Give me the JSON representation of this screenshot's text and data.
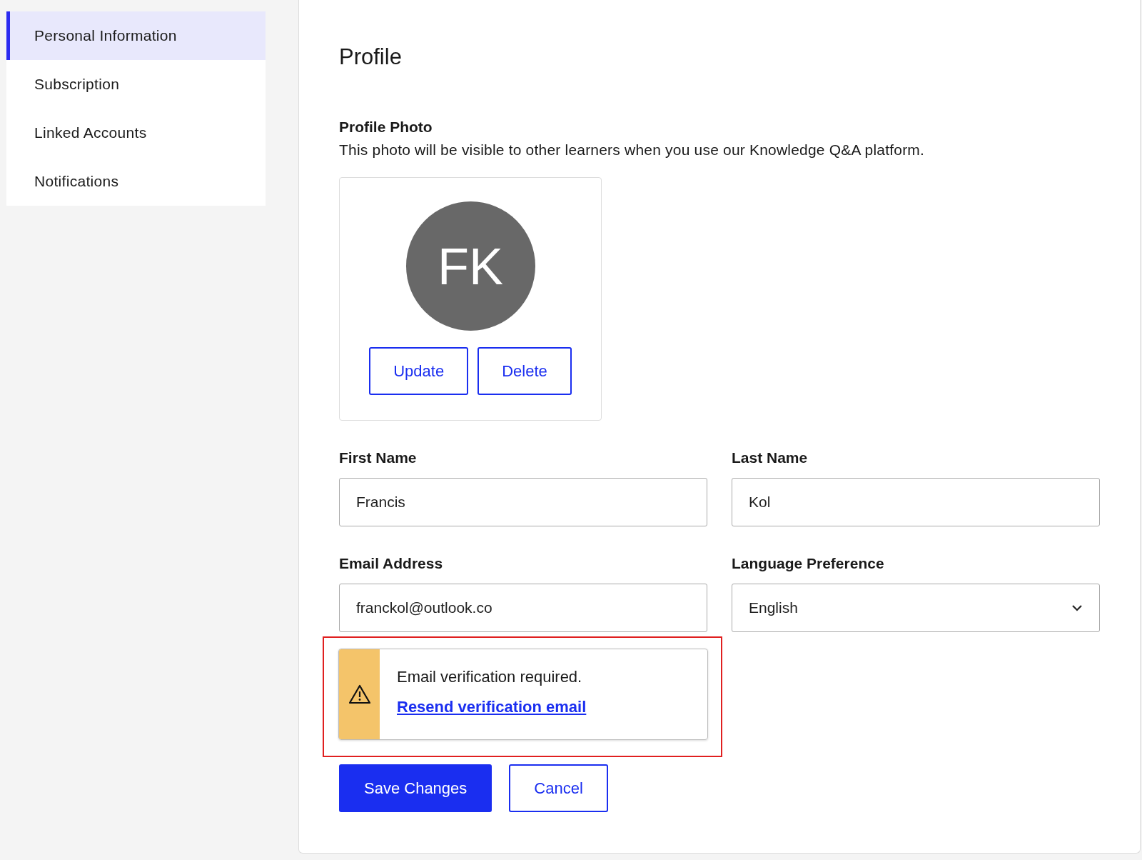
{
  "sidebar": {
    "items": [
      {
        "label": "Personal Information",
        "selected": true
      },
      {
        "label": "Subscription",
        "selected": false
      },
      {
        "label": "Linked Accounts",
        "selected": false
      },
      {
        "label": "Notifications",
        "selected": false
      }
    ]
  },
  "profile": {
    "title": "Profile",
    "photo_label": "Profile Photo",
    "photo_description": "This photo will be visible to other learners when you use our Knowledge Q&A platform.",
    "initials": "FK",
    "photo_buttons": [
      "Update",
      "Delete"
    ]
  },
  "fields": [
    {
      "kind": "text",
      "label": "First Name",
      "value": "Francis"
    },
    {
      "kind": "text",
      "label": "Last Name",
      "value": "Kol"
    },
    {
      "kind": "text",
      "label": "Email Address",
      "value": "franckol@outlook.co"
    },
    {
      "kind": "select",
      "label": "Language Preference",
      "value": "English"
    }
  ],
  "alert": {
    "message": "Email verification required.",
    "link": "Resend verification email",
    "highlighted": true
  },
  "buttons": [
    {
      "kind": "primary",
      "label": "Save Changes"
    },
    {
      "kind": "secondary",
      "label": "Cancel"
    }
  ]
}
